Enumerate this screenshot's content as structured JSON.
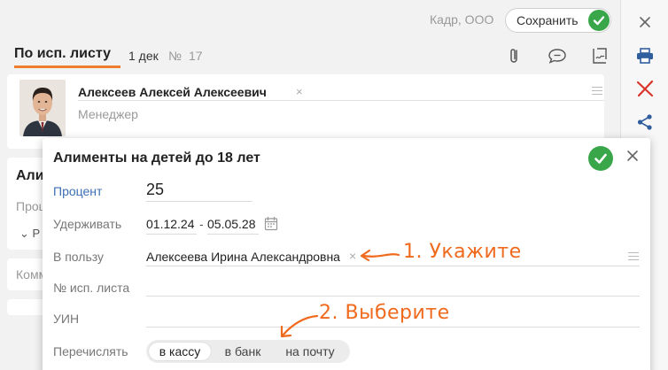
{
  "topbar": {
    "org": "Кадр, ООО",
    "save_label": "Сохранить"
  },
  "document": {
    "title": "По исп. листу",
    "date": "1 дек",
    "number_sign": "№",
    "number": "17"
  },
  "employee": {
    "name": "Алексеев Алексей Алексеевич",
    "remove": "×",
    "position": "Менеджер"
  },
  "background_card": {
    "title_partial": "Али",
    "label_partial": "Проц",
    "dropdown_partial": "⌄ Р",
    "comment_partial": "Комм"
  },
  "dialog": {
    "title": "Алименты на детей до 18 лет",
    "fields": {
      "percent": {
        "label": "Процент",
        "value": "25"
      },
      "withhold": {
        "label": "Удерживать",
        "date_from": "01.12.24",
        "separator": "-",
        "date_to": "05.05.28"
      },
      "beneficiary": {
        "label": "В пользу",
        "value": "Алексеева Ирина Александровна",
        "remove": "×"
      },
      "writ_number": {
        "label": "№ исп. листа",
        "value": ""
      },
      "uin": {
        "label": "УИН",
        "value": ""
      },
      "transfer": {
        "label": "Перечислять",
        "options": [
          "в кассу",
          "в банк",
          "на почту"
        ],
        "selected": "в кассу"
      }
    }
  },
  "annotations": {
    "step1": "1. Укажите",
    "step2": "2. Выберите"
  },
  "colors": {
    "accent": "#f07c2e",
    "ok_green": "#3aa64a",
    "link_blue": "#3d6fb6",
    "annotation": "#f06a1d",
    "delete_red": "#d9342b"
  },
  "icons": [
    "check-icon",
    "close-icon",
    "paperclip-icon",
    "chat-icon",
    "sign-doc-icon",
    "printer-icon",
    "delete-icon",
    "share-icon",
    "calendar-icon",
    "menu-icon",
    "arrow-icon"
  ]
}
